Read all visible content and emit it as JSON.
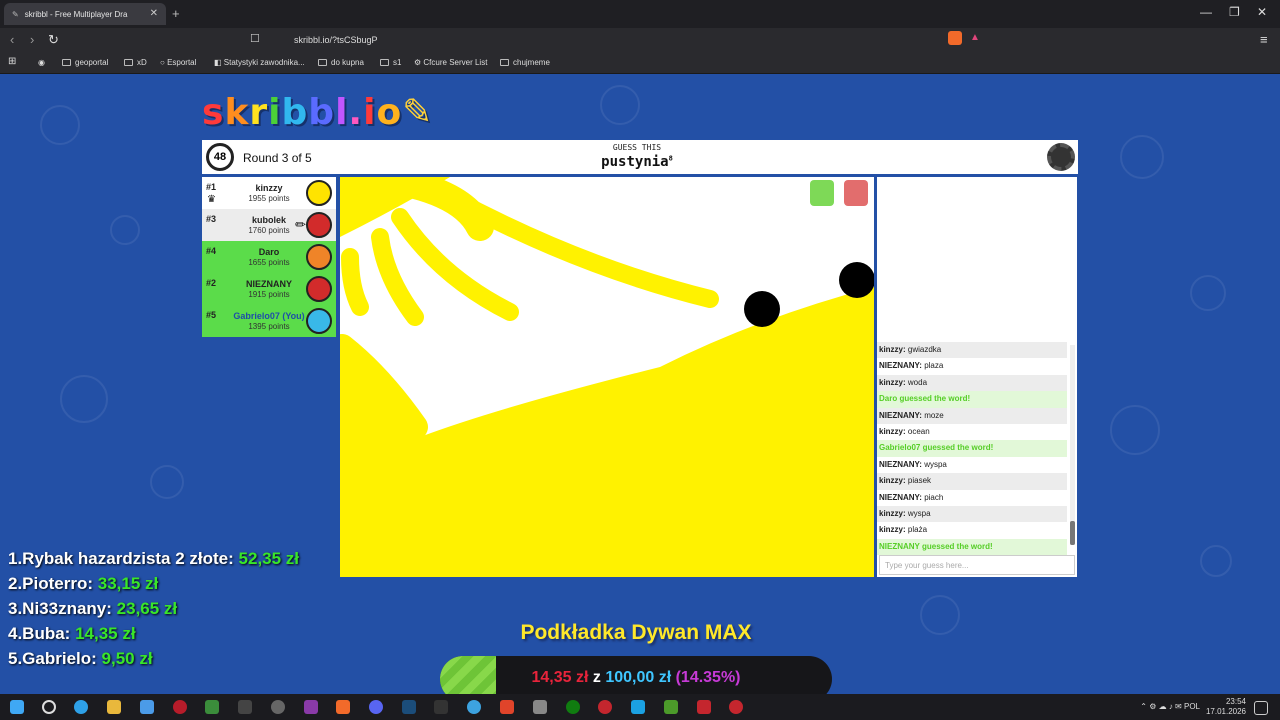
{
  "browser": {
    "tab_title": "skribbl - Free Multiplayer Dra",
    "new_tab": "+",
    "url": "skribbl.io/?tsCSbugP",
    "bookmarks": [
      "geoportal",
      "xD",
      "Esportal",
      "Statystyki zawodnika...",
      "do kupna",
      "s1",
      "Cfcure Server List",
      "chujmeme"
    ]
  },
  "logo": "skribbl.io",
  "game": {
    "timer": "48",
    "round": "Round 3 of 5",
    "guess_label": "GUESS THIS",
    "word": "pustynia",
    "word_length": "8"
  },
  "players": [
    {
      "rank": "#1",
      "name": "kinzzy",
      "points": "1955 points",
      "bg": "#ffffff",
      "avatar": "#ffe300"
    },
    {
      "rank": "#3",
      "name": "kubolek",
      "points": "1760 points",
      "bg": "#ececec",
      "avatar": "#d22b2b"
    },
    {
      "rank": "#4",
      "name": "Daro",
      "points": "1655 points",
      "bg": "#5bdc4a",
      "avatar": "#ef8428"
    },
    {
      "rank": "#2",
      "name": "NIEZNANY",
      "points": "1915 points",
      "bg": "#5bdc4a",
      "avatar": "#d22b2b"
    },
    {
      "rank": "#5",
      "name": "Gabrielo07 (You)",
      "points": "1395 points",
      "bg": "#5bdc4a",
      "avatar": "#39b8e8"
    }
  ],
  "chat": [
    {
      "user": "kinzzy",
      "text": "gwiazdka",
      "type": "alt"
    },
    {
      "user": "NIEZNANY",
      "text": "plaza",
      "type": "normal"
    },
    {
      "user": "kinzzy",
      "text": "woda",
      "type": "alt"
    },
    {
      "user": "",
      "text": "Daro guessed the word!",
      "type": "ok"
    },
    {
      "user": "NIEZNANY",
      "text": "moze",
      "type": "alt"
    },
    {
      "user": "kinzzy",
      "text": "ocean",
      "type": "normal"
    },
    {
      "user": "",
      "text": "Gabrielo07 guessed the word!",
      "type": "ok"
    },
    {
      "user": "NIEZNANY",
      "text": "wyspa",
      "type": "normal"
    },
    {
      "user": "kinzzy",
      "text": "piasek",
      "type": "alt"
    },
    {
      "user": "NIEZNANY",
      "text": "piach",
      "type": "normal"
    },
    {
      "user": "kinzzy",
      "text": "wyspa",
      "type": "alt"
    },
    {
      "user": "kinzzy",
      "text": "plaża",
      "type": "normal"
    },
    {
      "user": "",
      "text": "NIEZNANY guessed the word!",
      "type": "ok"
    }
  ],
  "chat_placeholder": "Type your guess here...",
  "leaderboard": [
    {
      "label": "1.Rybak hazardzista 2 złote: ",
      "amount": "52,35 zł"
    },
    {
      "label": "2.Pioterro: ",
      "amount": "33,15 zł"
    },
    {
      "label": "3.Ni33znany: ",
      "amount": "23,65 zł"
    },
    {
      "label": "4.Buba: ",
      "amount": "14,35 zł"
    },
    {
      "label": "5.Gabrielo: ",
      "amount": "9,50 zł"
    }
  ],
  "goal": {
    "title": "Podkładka Dywan MAX",
    "current": "14,35 zł",
    "sep": " z ",
    "target": "100,00 zł",
    "percent_label": " (14.35%)",
    "progress": 0.1435
  },
  "taskbar": {
    "lang": "POL",
    "time": "23:54",
    "date": "17.01.2026"
  }
}
